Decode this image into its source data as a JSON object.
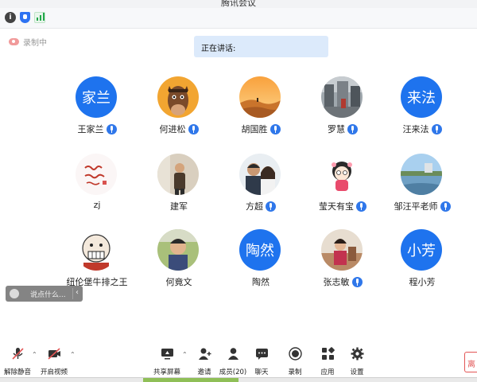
{
  "window": {
    "title": "腾讯会议"
  },
  "status": {
    "recording_label": "录制中",
    "speaking_label": "正在讲话:"
  },
  "participants": [
    {
      "name": "王家兰",
      "avatar_text": "家兰",
      "mic": true,
      "avatar_type": "text"
    },
    {
      "name": "何进松",
      "avatar_text": "",
      "mic": true,
      "avatar_type": "horse-cartoon"
    },
    {
      "name": "胡国胜",
      "avatar_text": "",
      "mic": true,
      "avatar_type": "desert-photo"
    },
    {
      "name": "罗慧",
      "avatar_text": "",
      "mic": true,
      "avatar_type": "street-photo"
    },
    {
      "name": "汪来法",
      "avatar_text": "来法",
      "mic": true,
      "avatar_type": "text"
    },
    {
      "name": "zj",
      "avatar_text": "",
      "mic": false,
      "avatar_type": "calligraphy"
    },
    {
      "name": "建军",
      "avatar_text": "",
      "mic": false,
      "avatar_type": "person-indoor"
    },
    {
      "name": "方超",
      "avatar_text": "",
      "mic": true,
      "avatar_type": "couple-photo"
    },
    {
      "name": "莹天有宝",
      "avatar_text": "",
      "mic": true,
      "avatar_type": "cartoon-girl"
    },
    {
      "name": "邹汪平老师",
      "avatar_text": "",
      "mic": true,
      "avatar_type": "lake-photo"
    },
    {
      "name": "纽伦堡牛排之王",
      "avatar_text": "",
      "mic": false,
      "avatar_type": "cartoon-face"
    },
    {
      "name": "何竟文",
      "avatar_text": "",
      "mic": false,
      "avatar_type": "child-photo"
    },
    {
      "name": "陶然",
      "avatar_text": "陶然",
      "mic": false,
      "avatar_type": "text"
    },
    {
      "name": "张志敏",
      "avatar_text": "",
      "mic": true,
      "avatar_type": "girl-photo"
    },
    {
      "name": "程小芳",
      "avatar_text": "小芳",
      "mic": false,
      "avatar_type": "text"
    }
  ],
  "chat_input": {
    "placeholder": "说点什么..."
  },
  "toolbar": {
    "unmute": "解除静音",
    "start_video": "开启视频",
    "share_screen": "共享屏幕",
    "invite": "邀请",
    "members": "成员(20)",
    "chat": "聊天",
    "record": "录制",
    "apps": "应用",
    "settings": "设置",
    "leave": "离"
  },
  "colors": {
    "accent": "#1e73ee",
    "speaking_bg": "#dceafb",
    "danger": "#e25555"
  }
}
